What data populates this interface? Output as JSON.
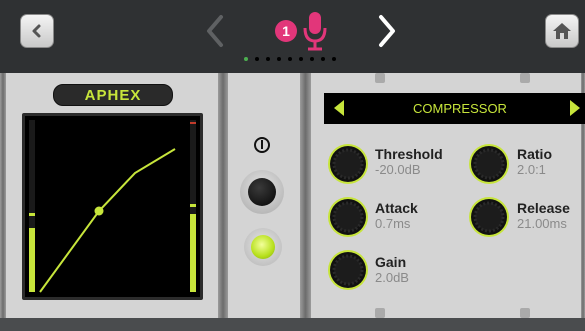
{
  "topbar": {
    "channel_number": "1",
    "page_dots": 9,
    "active_dot_index": 0,
    "icons": [
      "back-icon",
      "prev-arrow-icon",
      "microphone-icon",
      "next-arrow-icon",
      "home-icon"
    ]
  },
  "left_panel": {
    "brand": "APHEX"
  },
  "right_panel": {
    "module": "COMPRESSOR",
    "params": {
      "threshold": {
        "label": "Threshold",
        "value": "-20.0dB"
      },
      "ratio": {
        "label": "Ratio",
        "value": "2.0:1"
      },
      "attack": {
        "label": "Attack",
        "value": "0.7ms"
      },
      "release": {
        "label": "Release",
        "value": "21.00ms"
      },
      "gain": {
        "label": "Gain",
        "value": "2.0dB"
      }
    }
  },
  "colors": {
    "accent_green": "#c7e53b",
    "channel_pink": "#e2367a",
    "dot_active": "#4caf50"
  }
}
